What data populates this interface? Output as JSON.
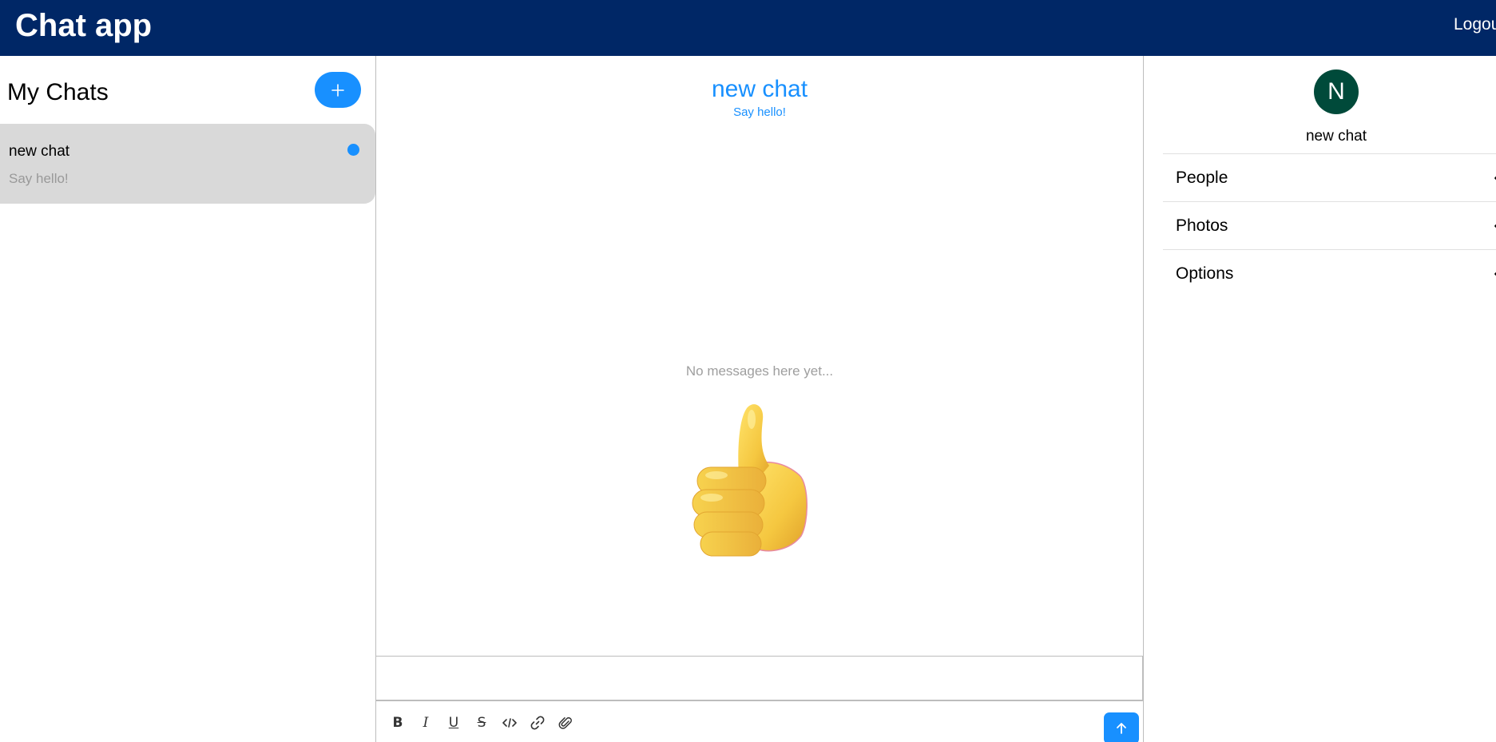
{
  "header": {
    "title": "Chat app",
    "logout_label": "Logout"
  },
  "sidebar": {
    "title": "My Chats",
    "new_chat_icon": "plus-icon",
    "chats": [
      {
        "title": "new chat",
        "preview": "Say hello!",
        "unread": true
      }
    ]
  },
  "main": {
    "title": "new chat",
    "subtitle": "Say hello!",
    "empty_text": "No messages here yet...",
    "empty_illustration": "thumbs-up-emoji",
    "composer": {
      "value": "",
      "tools": [
        "bold-icon",
        "italic-icon",
        "underline-icon",
        "strikethrough-icon",
        "code-icon",
        "link-icon",
        "attachment-icon"
      ],
      "send_icon": "arrow-up-icon"
    }
  },
  "details": {
    "avatar_letter": "N",
    "name": "new chat",
    "sections": [
      {
        "label": "People"
      },
      {
        "label": "Photos"
      },
      {
        "label": "Options"
      }
    ]
  },
  "colors": {
    "header_bg": "#002766",
    "accent": "#1890ff",
    "card_bg": "#d9d9d9",
    "avatar_bg": "#004a3a",
    "muted_text": "#999999"
  }
}
